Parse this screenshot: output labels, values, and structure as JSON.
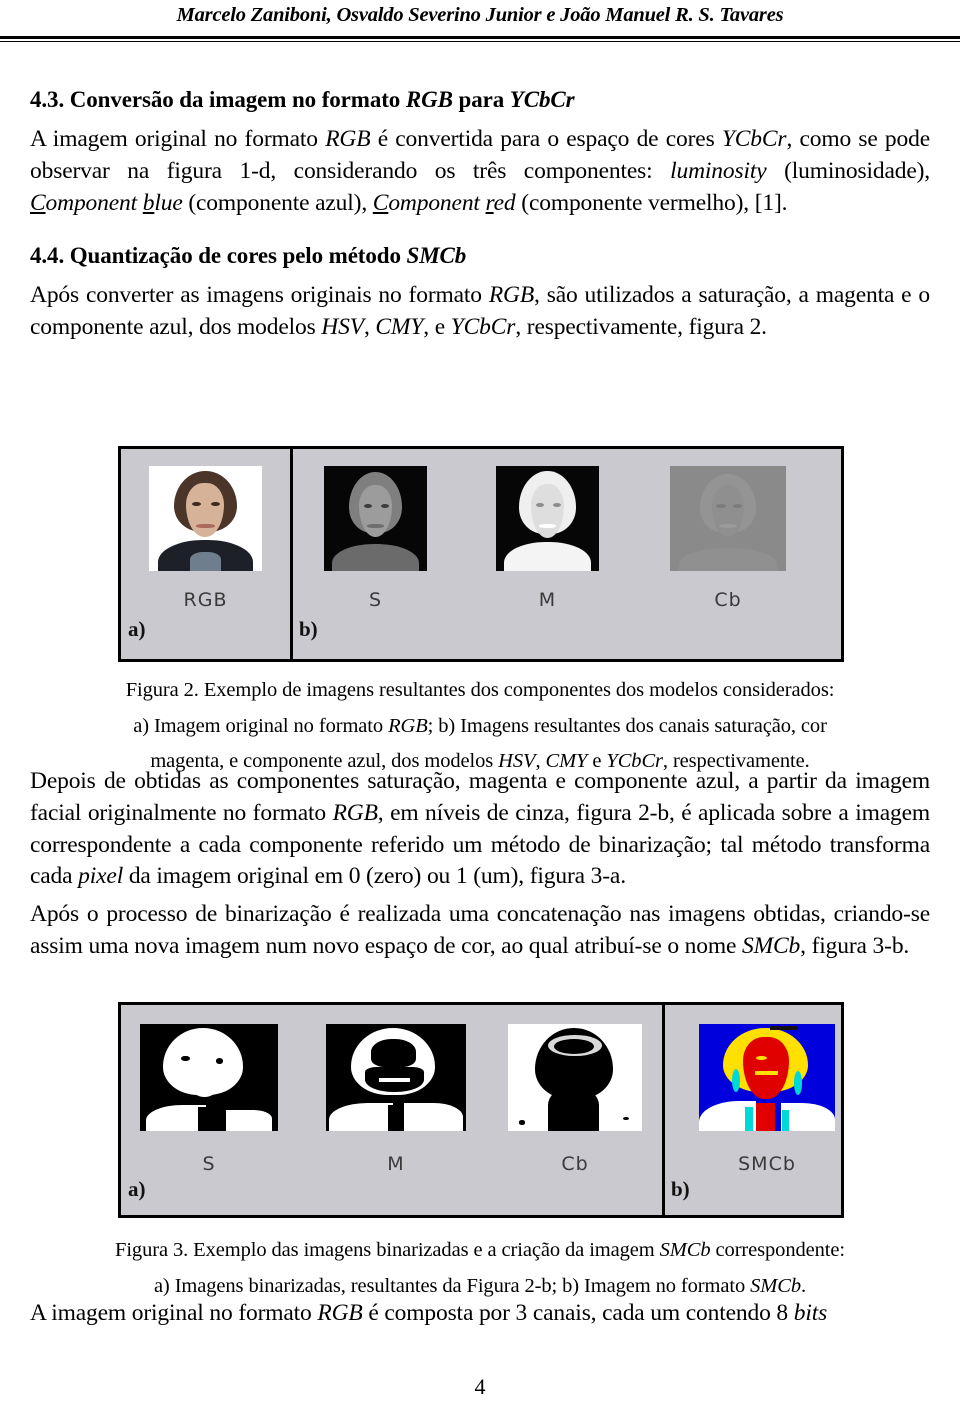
{
  "header": {
    "running_head": "Marcelo Zaniboni, Osvaldo Severino Junior e João Manuel R. S. Tavares"
  },
  "sections": [
    {
      "number": "4.3.",
      "title_plain": "4.3. Conversão da imagem no formato RGB para YCbCr",
      "title_prefix": "4.3. Conversão da imagem no formato ",
      "title_em1": "RGB",
      "title_mid": " para ",
      "title_em2": "YCbCr",
      "body": "A imagem original no formato RGB é convertida para o espaço de cores YCbCr, como se pode observar na figura 1-d, considerando os três componentes: luminosity (luminosidade), Component blue (componente azul), Component red (componente vermelho), [1]."
    },
    {
      "number": "4.4.",
      "title_plain": "4.4. Quantização de cores pelo método SMCb",
      "title_prefix": "4.4. Quantização de cores pelo método ",
      "title_em1": "SMCb",
      "body": "Após converter as imagens originais no formato RGB, são utilizados a saturação, a magenta e o componente azul, dos modelos HSV, CMY, e YCbCr, respectivamente, figura 2."
    }
  ],
  "paragraphs": {
    "p_after_fig2": "Depois de obtidas as componentes saturação, magenta e componente azul, a partir da imagem facial originalmente no formato RGB, em níveis de cinza, figura 2-b, é aplicada sobre a imagem correspondente a cada componente referido um método de binarização; tal método transforma cada pixel da imagem original em 0 (zero) ou 1 (um), figura 3-a.",
    "p_concat": "Após o processo de binarização é realizada uma concatenação nas imagens obtidas, criando-se assim uma nova imagem num novo espaço de cor, ao qual atribuí-se o nome SMCb, figura 3-b.",
    "p_final": "A imagem original no formato RGB é composta por 3 canais, cada um contendo 8 bits"
  },
  "figure2": {
    "panel_a_letter": "a)",
    "panel_b_letter": "b)",
    "labels": [
      "RGB",
      "S",
      "M",
      "Cb"
    ],
    "caption_line1": "Figura 2. Exemplo de imagens resultantes dos componentes dos modelos considerados:",
    "caption_line2": "a) Imagem original no formato RGB; b) Imagens resultantes dos canais saturação, cor",
    "caption_line3": "magenta, e componente azul, dos modelos HSV, CMY e YCbCr, respectivamente.",
    "caption_full": "Figura 2. Exemplo de imagens resultantes dos componentes dos modelos considerados: a) Imagem original no formato RGB; b) Imagens resultantes dos canais saturação, cor magenta, e componente azul, dos modelos HSV, CMY e YCbCr, respectivamente."
  },
  "figure3": {
    "panel_a_letter": "a)",
    "panel_b_letter": "b)",
    "labels": [
      "S",
      "M",
      "Cb",
      "SMCb"
    ],
    "caption_line1": "Figura 3. Exemplo das imagens binarizadas e a criação da imagem SMCb correspondente:",
    "caption_line2": "a) Imagens binarizadas, resultantes da Figura 2-b; b) Imagem no formato SMCb.",
    "caption_full": "Figura 3. Exemplo das imagens binarizadas e a criação da imagem SMCb correspondente: a) Imagens binarizadas, resultantes da Figura 2-b; b) Imagem no formato SMCb."
  },
  "footer": {
    "page_number": "4"
  },
  "colors": {
    "figure_background": "#c9c9cf",
    "figure_border": "#000000",
    "smcb_blue": "#0000dd",
    "smcb_red": "#e00000",
    "smcb_yellow": "#ffe000",
    "smcb_cyan": "#00d8d8",
    "smcb_white": "#ffffff",
    "cb_gray": "#8a8a8a"
  }
}
